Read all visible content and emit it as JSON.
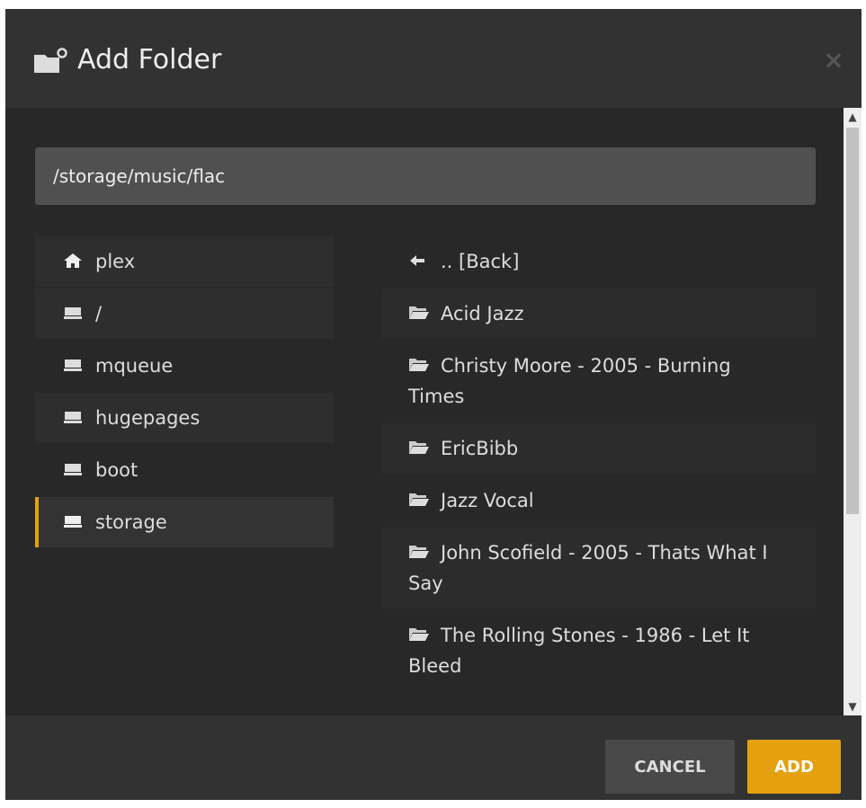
{
  "dialog": {
    "title": "Add Folder",
    "close_icon": "close-icon",
    "title_icon": "add-folder-icon"
  },
  "path": {
    "value": "/storage/music/flac"
  },
  "drives": [
    {
      "label": "plex",
      "icon": "home-icon",
      "selected": false
    },
    {
      "label": "/",
      "icon": "drive-icon",
      "selected": false
    },
    {
      "label": "mqueue",
      "icon": "drive-icon",
      "selected": false
    },
    {
      "label": "hugepages",
      "icon": "drive-icon",
      "selected": false
    },
    {
      "label": "boot",
      "icon": "drive-icon",
      "selected": false
    },
    {
      "label": "storage",
      "icon": "drive-icon",
      "selected": true
    }
  ],
  "folders": [
    {
      "label": ".. [Back]",
      "icon": "back-arrow-icon"
    },
    {
      "label": "Acid Jazz",
      "icon": "folder-icon"
    },
    {
      "label": "Christy Moore - 2005 - Burning Times",
      "icon": "folder-icon"
    },
    {
      "label": "EricBibb",
      "icon": "folder-icon"
    },
    {
      "label": "Jazz Vocal",
      "icon": "folder-icon"
    },
    {
      "label": "John Scofield - 2005 - Thats What I Say",
      "icon": "folder-icon"
    },
    {
      "label": "The Rolling Stones - 1986 - Let It Bleed",
      "icon": "folder-icon"
    }
  ],
  "footer": {
    "cancel_label": "CANCEL",
    "add_label": "ADD"
  },
  "colors": {
    "accent": "#e5a00d",
    "background": "#282828"
  }
}
